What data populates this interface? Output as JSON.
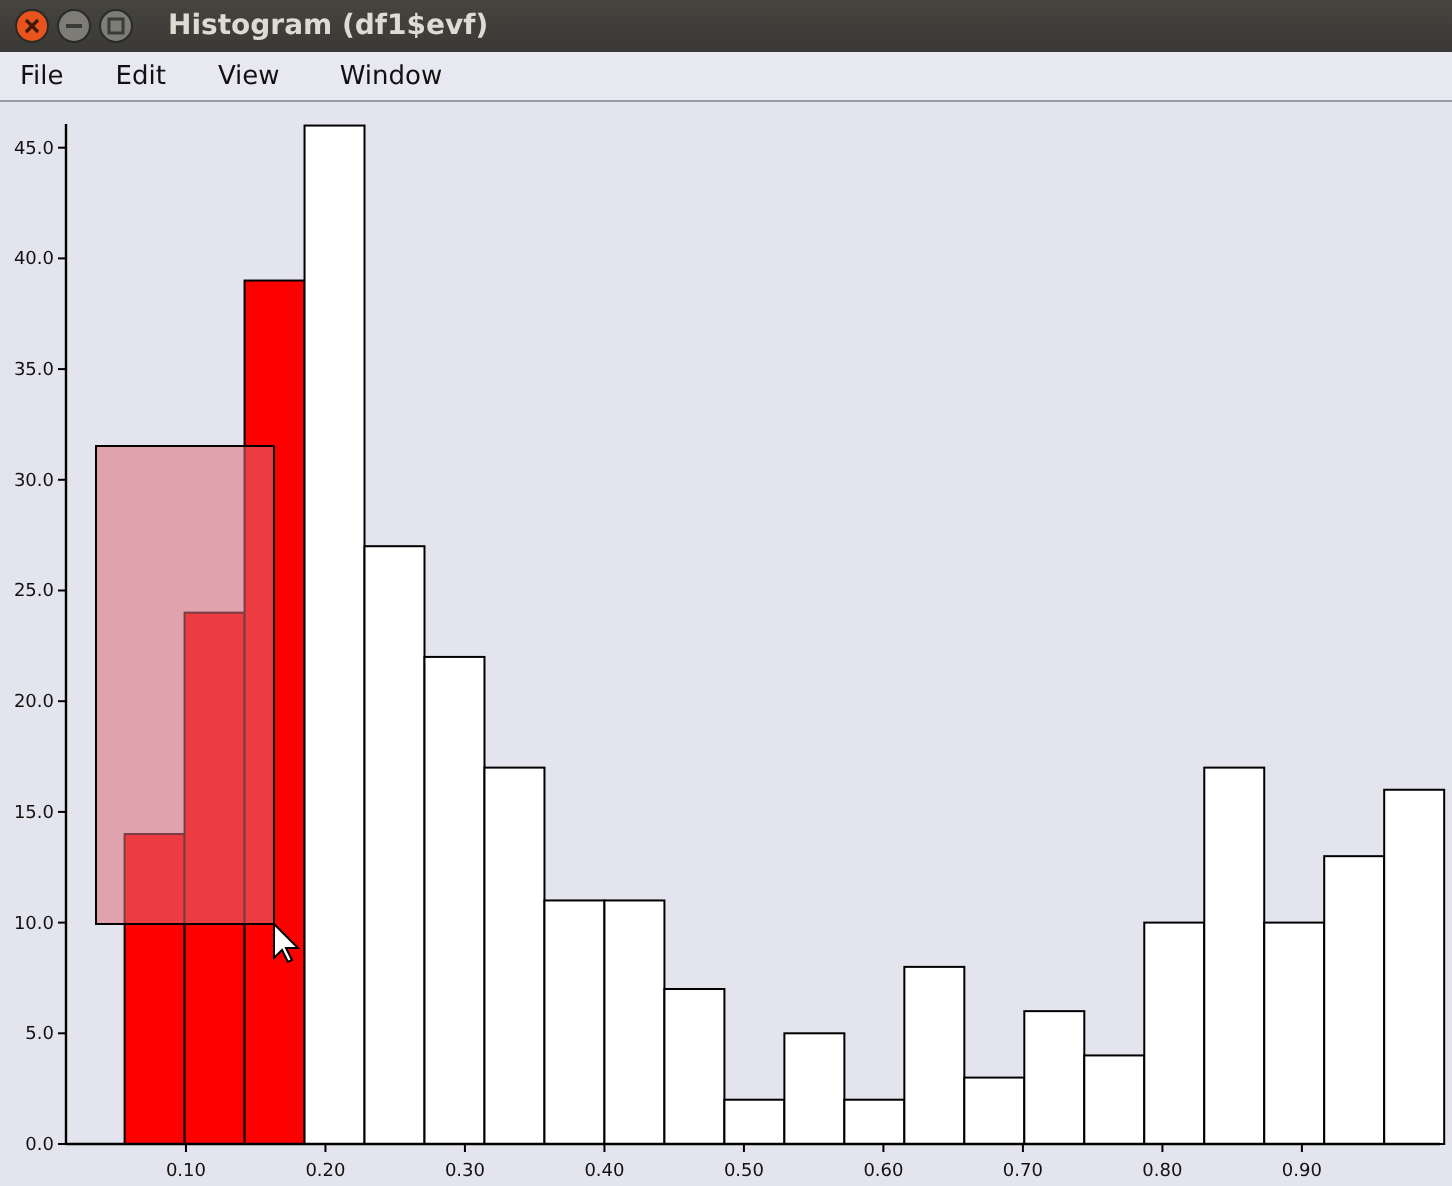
{
  "window": {
    "title": "Histogram (df1$evf)"
  },
  "menu": [
    {
      "label": "File"
    },
    {
      "label": "Edit"
    },
    {
      "label": "View"
    },
    {
      "label": "Window"
    }
  ],
  "chart_data": {
    "type": "bar",
    "xlim": [
      0.014,
      0.999
    ],
    "ylim": [
      0,
      46.07
    ],
    "x": [
      0.056,
      0.099,
      0.142,
      0.185,
      0.228,
      0.271,
      0.314,
      0.357,
      0.4,
      0.443,
      0.486,
      0.529,
      0.572,
      0.615,
      0.658,
      0.701,
      0.744,
      0.787,
      0.83,
      0.873,
      0.916,
      0.959
    ],
    "series": [
      {
        "color": "#ff0000",
        "values": [
          14,
          24,
          39,
          null,
          null,
          null,
          null,
          null,
          null,
          null,
          null,
          null,
          null,
          null,
          null,
          null,
          null,
          null,
          null,
          null,
          null,
          null
        ]
      },
      {
        "color": "#ffffff",
        "values": [
          null,
          null,
          null,
          46,
          27,
          22,
          17,
          11,
          11,
          7,
          2,
          5,
          2,
          8,
          3,
          6,
          4,
          10,
          17,
          10,
          13,
          16
        ]
      }
    ],
    "xticks": [
      {
        "value": 0.1,
        "label": "0.10"
      },
      {
        "value": 0.2,
        "label": "0.20"
      },
      {
        "value": 0.3,
        "label": "0.30"
      },
      {
        "value": 0.4,
        "label": "0.40"
      },
      {
        "value": 0.5,
        "label": "0.50"
      },
      {
        "value": 0.6,
        "label": "0.60"
      },
      {
        "value": 0.7,
        "label": "0.70"
      },
      {
        "value": 0.8,
        "label": "0.80"
      },
      {
        "value": 0.9,
        "label": "0.90"
      }
    ],
    "yticks": [
      {
        "value": 0,
        "label": "0.0"
      },
      {
        "value": 5,
        "label": "5.0"
      },
      {
        "value": 10,
        "label": "10.0"
      },
      {
        "value": 15,
        "label": "15.0"
      },
      {
        "value": 20,
        "label": "20.0"
      },
      {
        "value": 25,
        "label": "25.0"
      },
      {
        "value": 30,
        "label": "30.0"
      },
      {
        "value": 35,
        "label": "35.0"
      },
      {
        "value": 40,
        "label": "40.0"
      },
      {
        "value": 45,
        "label": "45.0"
      }
    ]
  }
}
